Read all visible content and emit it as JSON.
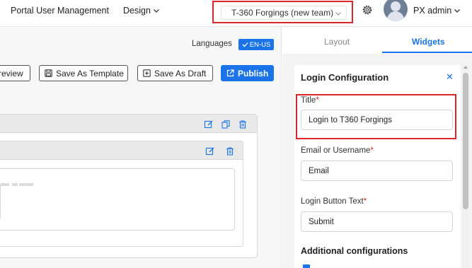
{
  "header": {
    "nav": [
      {
        "label": "Portal User Management"
      },
      {
        "label": "Design"
      }
    ],
    "team_select": {
      "value": "T-360 Forgings (new team)"
    },
    "user": {
      "name": "PX admin"
    }
  },
  "canvas": {
    "languages_label": "Languages",
    "language_badge": "EN-US",
    "buttons": {
      "preview": "review",
      "save_template": "Save As Template",
      "save_draft": "Save As Draft",
      "publish": "Publish"
    }
  },
  "side_panel": {
    "tabs": [
      {
        "label": "Layout",
        "active": false
      },
      {
        "label": "Widgets",
        "active": true
      }
    ],
    "card_title": "Login Configuration",
    "fields": [
      {
        "label": "Title",
        "required_mark": "*",
        "value": "Login to T360 Forgings"
      },
      {
        "label": "Email or Username",
        "required_mark": "*",
        "value": "Email"
      },
      {
        "label": "Login Button Text",
        "required_mark": "*",
        "value": "Submit"
      }
    ],
    "additional_title": "Additional configurations"
  },
  "colors": {
    "accent": "#1a73e8",
    "highlight": "#d9262b"
  }
}
